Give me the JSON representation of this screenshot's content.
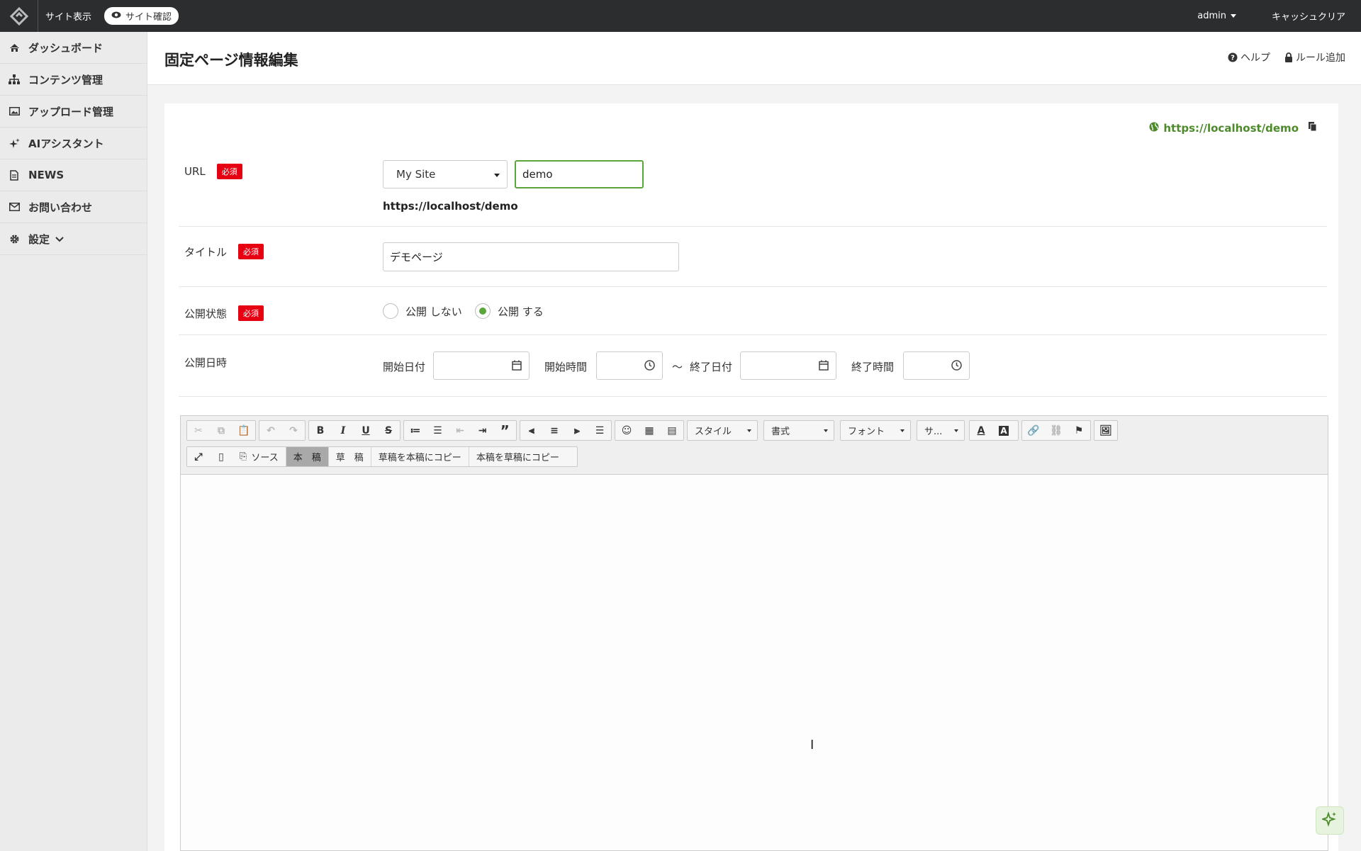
{
  "topbar": {
    "site_view": "サイト表示",
    "site_check": "サイト確認",
    "user": "admin",
    "cache_clear": "キャッシュクリア"
  },
  "sidebar": {
    "items": [
      {
        "label": "ダッシュボード",
        "icon": "home-icon"
      },
      {
        "label": "コンテンツ管理",
        "icon": "sitemap-icon"
      },
      {
        "label": "アップロード管理",
        "icon": "image-icon"
      },
      {
        "label": "AIアシスタント",
        "icon": "sparkle-icon"
      },
      {
        "label": "NEWS",
        "icon": "document-icon"
      },
      {
        "label": "お問い合わせ",
        "icon": "envelope-icon"
      },
      {
        "label": "設定",
        "icon": "gear-icon"
      }
    ]
  },
  "header": {
    "title": "固定ページ情報編集",
    "help": "ヘルプ",
    "add_rule": "ルール追加"
  },
  "form": {
    "live_url": "https://localhost/demo",
    "required": "必須",
    "url": {
      "label": "URL",
      "site_select": "My Site",
      "slug": "demo",
      "preview": "https://localhost/demo"
    },
    "title": {
      "label": "タイトル",
      "value": "デモページ"
    },
    "status": {
      "label": "公開状態",
      "options": [
        "公開 しない",
        "公開 する"
      ],
      "selected": "公開 する"
    },
    "schedule": {
      "label": "公開日時",
      "start_date": "開始日付",
      "start_time": "開始時間",
      "tilde": "〜",
      "end_date": "終了日付",
      "end_time": "終了時間"
    }
  },
  "editor": {
    "style_combo": "スタイル",
    "format_combo": "書式",
    "font_combo": "フォント",
    "size_combo": "サ...",
    "source": "ソース",
    "main_draft": "本　稿",
    "draft": "草　稿",
    "copy_draft_to_main": "草稿を本稿にコピー",
    "copy_main_to_draft": "本稿を草稿にコピー",
    "accent_color": "#5aa63a"
  }
}
